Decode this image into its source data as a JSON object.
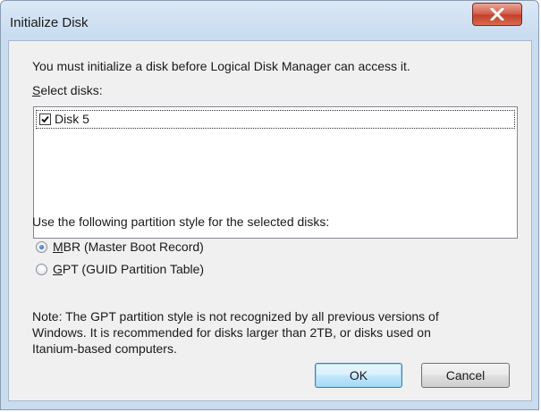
{
  "window": {
    "title": "Initialize Disk"
  },
  "dialog": {
    "intro_text": "You must initialize a disk before Logical Disk Manager can access it.",
    "select_disks_label": "Select disks:",
    "disks": [
      {
        "label": "Disk 5",
        "checked": true
      }
    ],
    "partition_style_label": "Use the following partition style for the selected disks:",
    "partition_options": [
      {
        "label": "MBR (Master Boot Record)",
        "selected": true
      },
      {
        "label": "GPT (GUID Partition Table)",
        "selected": false
      }
    ],
    "note_lines": [
      "Note: The GPT partition style is not recognized by all previous versions of",
      "Windows. It is recommended for disks larger than 2TB, or disks used on",
      "Itanium-based computers."
    ],
    "ok_label": "OK",
    "cancel_label": "Cancel"
  },
  "icons": {
    "close": "close-icon",
    "checkbox_checked": "checkmark-icon"
  },
  "colors": {
    "close_button": "#c4412b",
    "default_button_border": "#3c7fb1",
    "radio_selected": "#2a6bc9"
  }
}
